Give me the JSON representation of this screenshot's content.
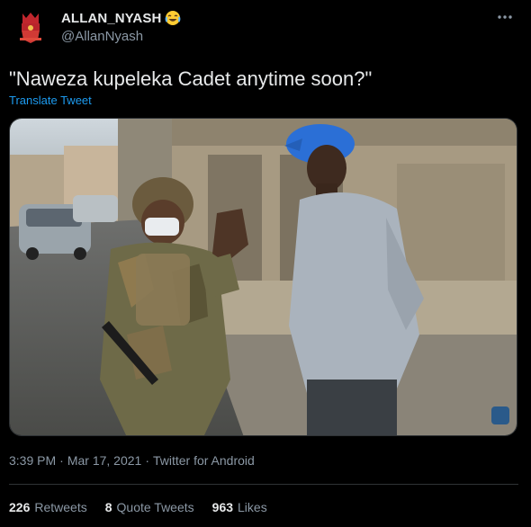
{
  "author": {
    "display_name": "ALLAN_NYASH",
    "emoji": "tears-of-joy-emoji",
    "handle": "@AllanNyash",
    "avatar_icon": "red-crest-avatar-icon"
  },
  "tweet": {
    "text": "\"Naweza kupeleka Cadet anytime soon?\"",
    "translate_label": "Translate Tweet"
  },
  "media": {
    "description_icon": "photo-soldier-and-man-icon"
  },
  "meta": {
    "time": "3:39 PM",
    "separator1": "·",
    "date": "Mar 17, 2021",
    "separator2": "·",
    "source": "Twitter for Android"
  },
  "stats": {
    "retweets_count": "226",
    "retweets_label": "Retweets",
    "quotes_count": "8",
    "quotes_label": "Quote Tweets",
    "likes_count": "963",
    "likes_label": "Likes"
  },
  "colors": {
    "background": "#000000",
    "link": "#1d9bf0",
    "muted": "#8b98a5",
    "text": "#e7e9ea",
    "divider": "#2f3336"
  }
}
